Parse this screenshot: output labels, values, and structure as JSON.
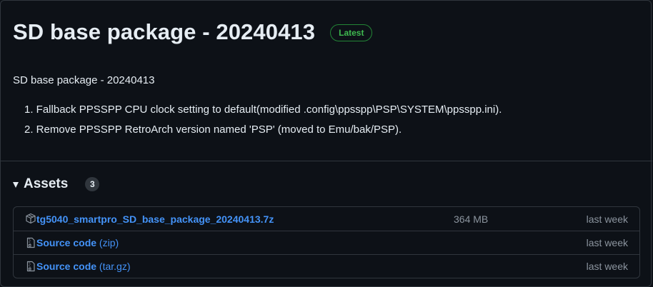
{
  "release": {
    "title": "SD base package - 20240413",
    "badge": "Latest",
    "body_heading": "SD base package - 20240413",
    "notes": [
      "1. Fallback PPSSPP CPU clock setting to default(modified .config\\ppsspp\\PSP\\SYSTEM\\ppsspp.ini).",
      "2. Remove PPSSPP RetroArch version named 'PSP' (moved to Emu/bak/PSP)."
    ]
  },
  "assets": {
    "title": "Assets",
    "count": "3",
    "items": [
      {
        "icon": "package-icon",
        "name": "tg5040_smartpro_SD_base_package_20240413.7z",
        "suffix": "",
        "size": "364 MB",
        "date": "last week"
      },
      {
        "icon": "file-zip-icon",
        "name": "Source code",
        "suffix": " (zip)",
        "size": "",
        "date": "last week"
      },
      {
        "icon": "file-zip-icon",
        "name": "Source code",
        "suffix": " (tar.gz)",
        "size": "",
        "date": "last week"
      }
    ]
  },
  "colors": {
    "background": "#0d1117",
    "border": "#30363d",
    "link": "#4493f8",
    "badge_green": "#3fb950",
    "muted": "#8b949e"
  }
}
